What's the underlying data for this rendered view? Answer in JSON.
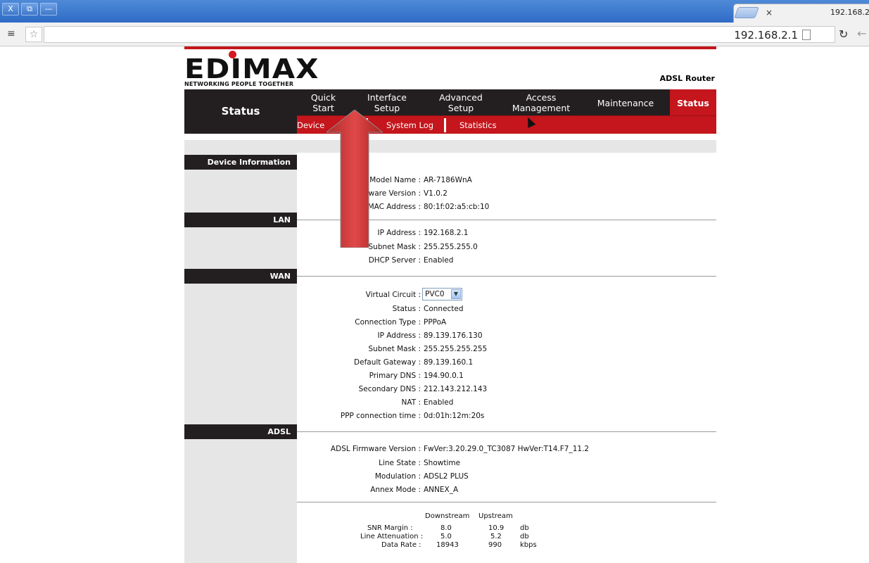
{
  "browser": {
    "tab_title": "192.168.2.",
    "tab_close": "×",
    "address": "192.168.2.1",
    "menu_icon": "≡",
    "star_icon": "☆",
    "reload_icon": "↻",
    "back_icon": "←",
    "window_buttons": [
      "X",
      "⧉",
      "—"
    ]
  },
  "router": {
    "logo_text": "EDIMAX",
    "logo_tagline": "NETWORKING PEOPLE TOGETHER",
    "product": "ADSL Router",
    "nav_left_label": "Status",
    "nav_tabs": [
      {
        "line1": "Quick",
        "line2": "Start"
      },
      {
        "line1": "Interface",
        "line2": "Setup"
      },
      {
        "line1": "Advanced",
        "line2": "Setup"
      },
      {
        "line1": "Access",
        "line2": "Management"
      },
      {
        "line1": "Maintenance",
        "line2": ""
      },
      {
        "line1": "Status",
        "line2": ""
      }
    ],
    "subnav": [
      "Device",
      "System Log",
      "Statistics"
    ]
  },
  "sections": {
    "device_info": {
      "title": "Device Information",
      "rows": [
        {
          "label": "Model Name :",
          "value": "AR-7186WnA"
        },
        {
          "label": "tware Version :",
          "value": "V1.0.2"
        },
        {
          "label": "MAC Address :",
          "value": "80:1f:02:a5:cb:10"
        }
      ]
    },
    "lan": {
      "title": "LAN",
      "rows": [
        {
          "label": "IP Address :",
          "value": "192.168.2.1"
        },
        {
          "label": "Subnet Mask :",
          "value": "255.255.255.0"
        },
        {
          "label": "DHCP Server :",
          "value": "Enabled"
        }
      ]
    },
    "wan": {
      "title": "WAN",
      "virtual_circuit_label": "Virtual Circuit :",
      "virtual_circuit_value": "PVC0",
      "rows": [
        {
          "label": "Status :",
          "value": "Connected"
        },
        {
          "label": "Connection Type :",
          "value": "PPPoA"
        },
        {
          "label": "IP Address :",
          "value": "89.139.176.130"
        },
        {
          "label": "Subnet Mask :",
          "value": "255.255.255.255"
        },
        {
          "label": "Default Gateway :",
          "value": "89.139.160.1"
        },
        {
          "label": "Primary DNS :",
          "value": "194.90.0.1"
        },
        {
          "label": "Secondary DNS :",
          "value": "212.143.212.143"
        },
        {
          "label": "NAT :",
          "value": "Enabled"
        },
        {
          "label": "PPP connection time :",
          "value": "0d:01h:12m:20s"
        }
      ]
    },
    "adsl": {
      "title": "ADSL",
      "rows": [
        {
          "label": "ADSL Firmware Version :",
          "value": "FwVer:3.20.29.0_TC3087 HwVer:T14.F7_11.2"
        },
        {
          "label": "Line State :",
          "value": "Showtime"
        },
        {
          "label": "Modulation :",
          "value": "ADSL2 PLUS"
        },
        {
          "label": "Annex Mode :",
          "value": "ANNEX_A"
        }
      ],
      "table": {
        "headers": [
          "Downstream",
          "Upstream"
        ],
        "rows": [
          {
            "label": "SNR Margin :",
            "down": "8.0",
            "up": "10.9",
            "unit": "db"
          },
          {
            "label": "Line Attenuation :",
            "down": "5.0",
            "up": "5.2",
            "unit": "db"
          },
          {
            "label": "Data Rate :",
            "down": "18943",
            "up": "990",
            "unit": "kbps"
          }
        ]
      }
    }
  },
  "colors": {
    "accent_red": "#c4161c",
    "dark": "#231f20",
    "sidebar_grey": "#e6e6e6",
    "arrow_red": "#d23b3b"
  }
}
